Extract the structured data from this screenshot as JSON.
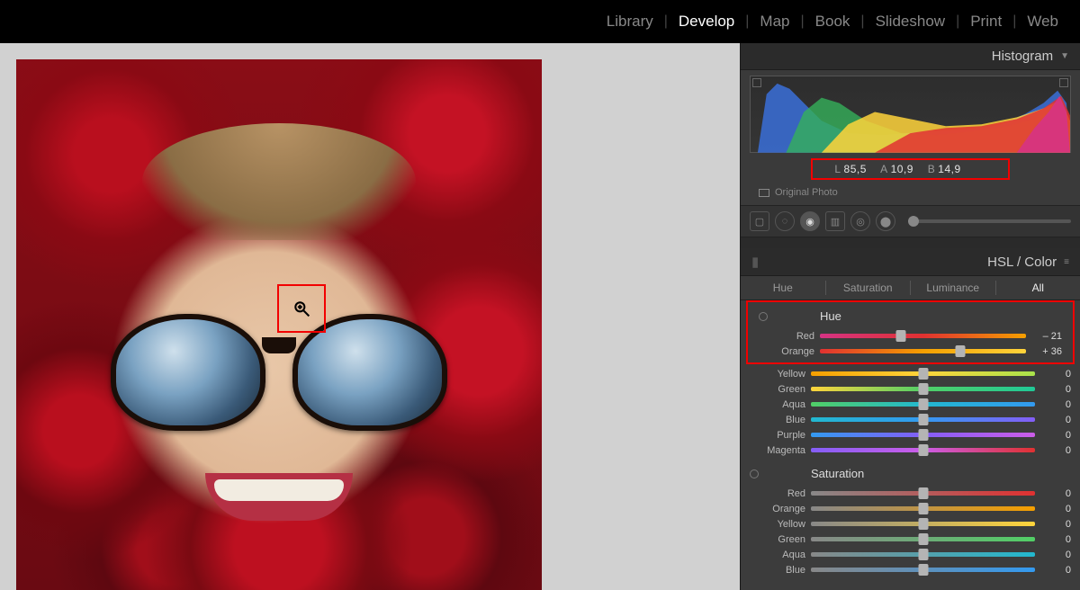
{
  "nav": {
    "items": [
      "Library",
      "Develop",
      "Map",
      "Book",
      "Slideshow",
      "Print",
      "Web"
    ],
    "active": "Develop"
  },
  "histogram": {
    "title": "Histogram",
    "lab": {
      "L_label": "L",
      "L": "85,5",
      "A_label": "A",
      "A": "10,9",
      "B_label": "B",
      "B": "14,9"
    },
    "compare_label": "Original Photo"
  },
  "hsl": {
    "title": "HSL / Color",
    "tabs": [
      "Hue",
      "Saturation",
      "Luminance",
      "All"
    ],
    "active_tab": "All",
    "hue": {
      "title": "Hue",
      "rows": [
        {
          "label": "Red",
          "value": -21,
          "class": "g-red",
          "pos": 39.5
        },
        {
          "label": "Orange",
          "value": 36,
          "class": "g-orange",
          "pos": 68
        },
        {
          "label": "Yellow",
          "value": 0,
          "class": "g-yellow",
          "pos": 50
        },
        {
          "label": "Green",
          "value": 0,
          "class": "g-green",
          "pos": 50
        },
        {
          "label": "Aqua",
          "value": 0,
          "class": "g-aqua",
          "pos": 50
        },
        {
          "label": "Blue",
          "value": 0,
          "class": "g-blue",
          "pos": 50
        },
        {
          "label": "Purple",
          "value": 0,
          "class": "g-purple",
          "pos": 50
        },
        {
          "label": "Magenta",
          "value": 0,
          "class": "g-magenta",
          "pos": 50
        }
      ]
    },
    "saturation": {
      "title": "Saturation",
      "rows": [
        {
          "label": "Red",
          "value": 0,
          "class": "s-red",
          "pos": 50
        },
        {
          "label": "Orange",
          "value": 0,
          "class": "s-orange",
          "pos": 50
        },
        {
          "label": "Yellow",
          "value": 0,
          "class": "s-yellow",
          "pos": 50
        },
        {
          "label": "Green",
          "value": 0,
          "class": "s-green",
          "pos": 50
        },
        {
          "label": "Aqua",
          "value": 0,
          "class": "s-aqua",
          "pos": 50
        },
        {
          "label": "Blue",
          "value": 0,
          "class": "s-blue",
          "pos": 50
        }
      ]
    }
  }
}
